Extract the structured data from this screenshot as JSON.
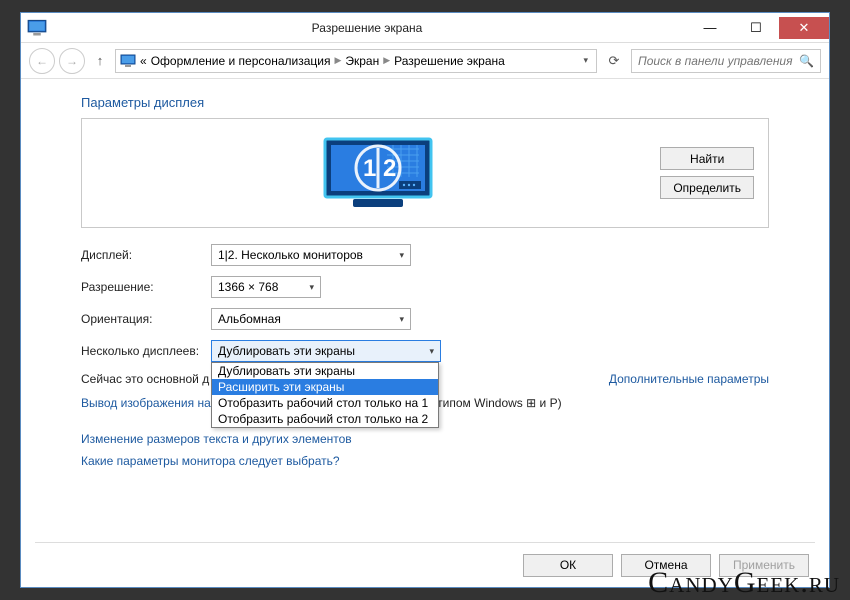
{
  "window": {
    "title": "Разрешение экрана"
  },
  "breadcrumb": {
    "prefix": "«",
    "items": [
      "Оформление и персонализация",
      "Экран",
      "Разрешение экрана"
    ]
  },
  "search": {
    "placeholder": "Поиск в панели управления"
  },
  "section_title": "Параметры дисплея",
  "buttons": {
    "find": "Найти",
    "identify": "Определить",
    "ok": "ОК",
    "cancel": "Отмена",
    "apply": "Применить"
  },
  "form": {
    "display_label": "Дисплей:",
    "display_value": "1|2. Несколько мониторов",
    "resolution_label": "Разрешение:",
    "resolution_value": "1366 × 768",
    "orientation_label": "Ориентация:",
    "orientation_value": "Альбомная",
    "multi_label": "Несколько дисплеев:",
    "multi_value": "Дублировать эти экраны",
    "multi_options": [
      "Дублировать эти экраны",
      "Расширить эти экраны",
      "Отобразить рабочий стол только на 1",
      "Отобразить рабочий стол только на 2"
    ]
  },
  "status_primary": "Сейчас это основной д",
  "advanced_link": "Дополнительные параметры",
  "projector_prefix": "Вывод изображения на",
  "projector_suffix_text": "отипом Windows",
  "projector_suffix_tail": " и P)",
  "links": {
    "text_size": "Изменение размеров текста и других элементов",
    "which_monitor": "Какие параметры монитора следует выбрать?"
  },
  "watermark": "CandyGeek.ru"
}
